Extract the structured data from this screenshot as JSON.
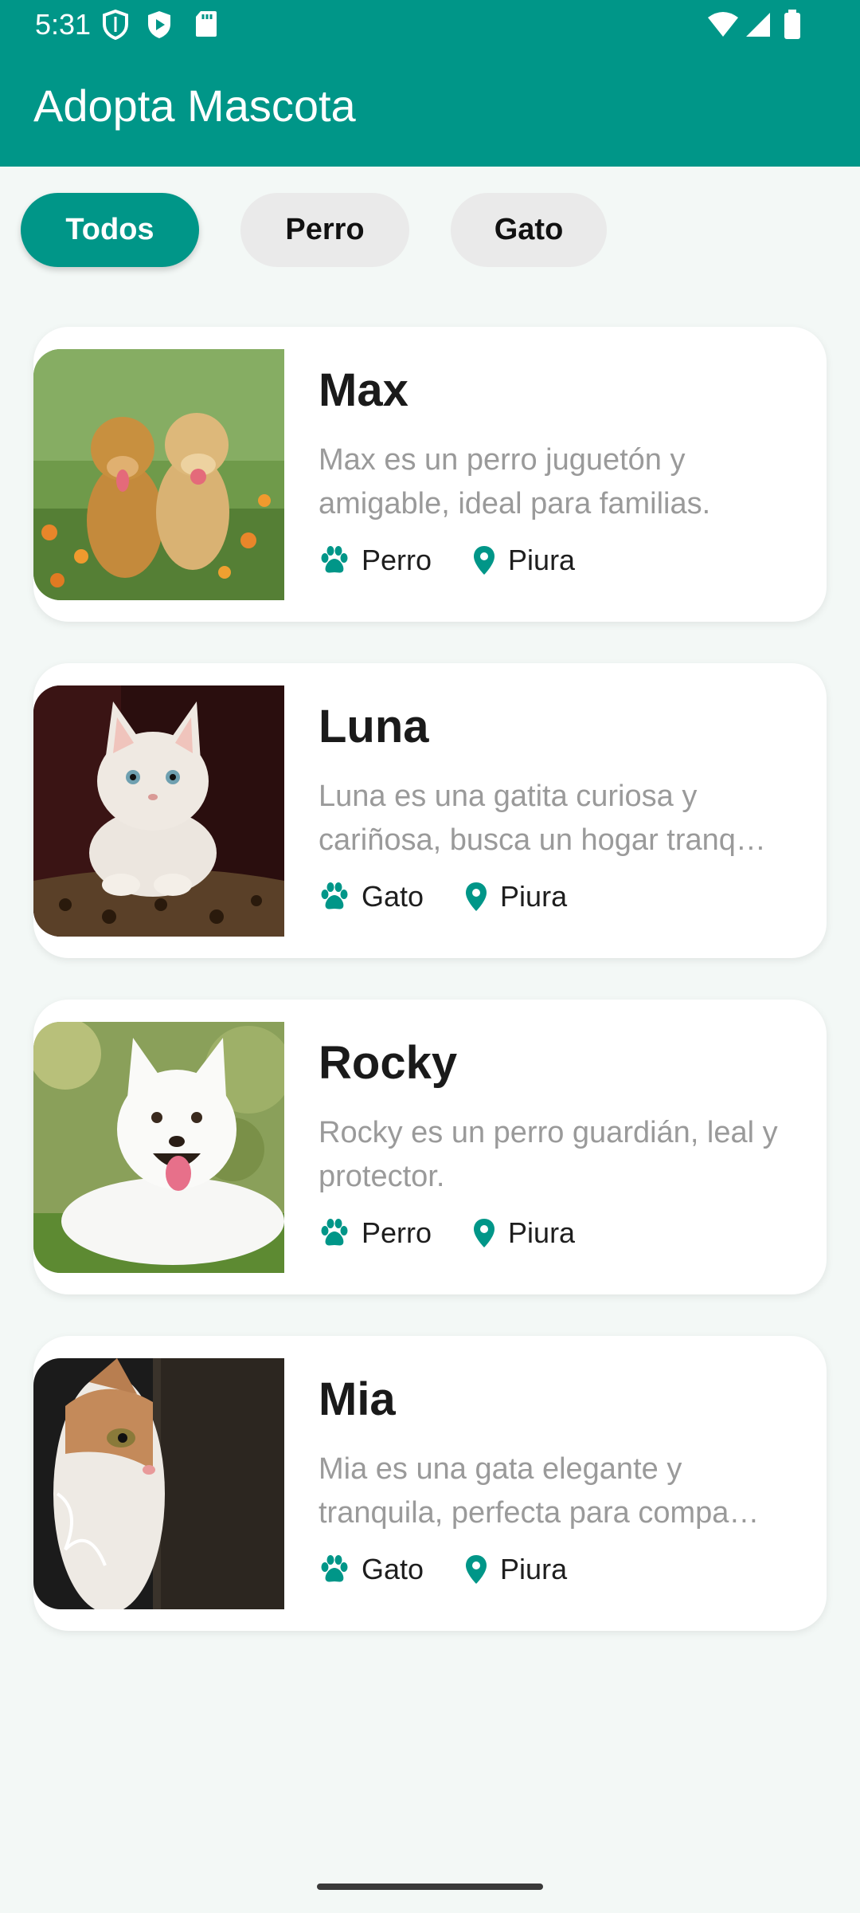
{
  "status_bar": {
    "time": "5:31"
  },
  "app_bar": {
    "title": "Adopta Mascota"
  },
  "filters": [
    {
      "label": "Todos",
      "active": true
    },
    {
      "label": "Perro",
      "active": false
    },
    {
      "label": "Gato",
      "active": false
    }
  ],
  "pets": [
    {
      "name": "Max",
      "description": "Max es un perro juguetón y amigable, ideal para familias.",
      "type": "Perro",
      "location": "Piura"
    },
    {
      "name": "Luna",
      "description": "Luna es una gatita curiosa y cariñosa, busca un hogar tranq…",
      "type": "Gato",
      "location": "Piura"
    },
    {
      "name": "Rocky",
      "description": "Rocky es un perro guardián, leal y protector.",
      "type": "Perro",
      "location": "Piura"
    },
    {
      "name": "Mia",
      "description": "Mia es una gata elegante y tranquila, perfecta para compa…",
      "type": "Gato",
      "location": "Piura"
    }
  ],
  "colors": {
    "primary": "#009688",
    "chip_inactive": "#eaeaea",
    "background": "#f3f8f6"
  },
  "icons": {
    "type": "paw-icon",
    "location": "location-pin-icon"
  }
}
